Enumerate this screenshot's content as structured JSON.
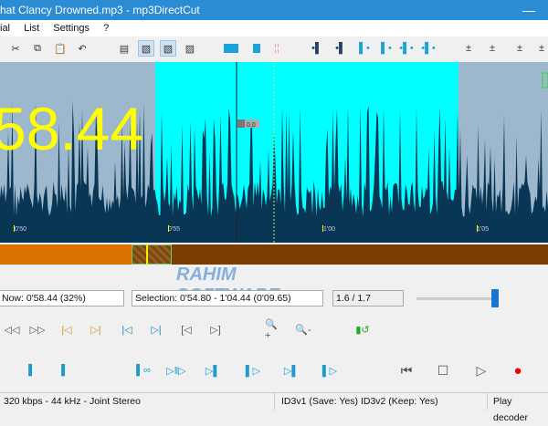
{
  "window": {
    "title": "hat Clancy Drowned.mp3 - mp3DirectCut",
    "minimize": "—"
  },
  "menu": [
    "ial",
    "List",
    "Settings",
    "?"
  ],
  "toolbar": {
    "icons": [
      "cut-icon",
      "copy-icon",
      "paste-icon",
      "undo-icon",
      "page-icon",
      "page-icon",
      "page-icon",
      "page-icon",
      "selection-block-icon",
      "selection-single-icon",
      "markers-icon",
      "set-begin-icon",
      "set-begin-icon",
      "set-end-icon",
      "set-end-icon",
      "set-both-icon",
      "set-both-icon",
      "cue-icon",
      "cue-icon",
      "cue-icon",
      "cue-icon"
    ]
  },
  "waveform": {
    "big_time": "58.44",
    "level_label": "0.0",
    "timeline": [
      "0'50",
      "0'55",
      "1'00",
      "1'05"
    ],
    "colors": {
      "bg": "#9db8cc",
      "selection": "#00ffff",
      "wave": "#0a3656"
    },
    "selection_start": "0'54",
    "selection_end": "1'04.44"
  },
  "fields": {
    "now": "Now: 0'58.44  (32%)",
    "selection": "Selection: 0'54.80 - 1'04.44 (0'09.65)",
    "counter": "1.6 / 1.7",
    "volume_fraction": 0.93
  },
  "nav_buttons": [
    "rewind-icon",
    "forward-icon",
    "prev-marker-icon",
    "next-marker-icon",
    "go-sel-start-icon",
    "go-sel-end-icon",
    "go-begin-icon",
    "go-end-icon",
    "zoom-in-icon",
    "zoom-out-icon",
    "level-undo-icon"
  ],
  "nav_glyphs": [
    "◁◁",
    "▷▷",
    "|◁",
    "▷|",
    "|◁",
    "▷|",
    "[◁",
    "▷]",
    "🔍+",
    "🔍-",
    "▮↺"
  ],
  "play_glyphs": [
    "▌",
    "▌",
    "▌∞",
    "▷‖▷",
    "▷▌",
    "▌▷",
    "▷▌",
    "▌▷",
    "⏮",
    "☐",
    "▷",
    "●"
  ],
  "status": {
    "format": "320 kbps - 44 kHz - Joint Stereo",
    "id3": "ID3v1 (Save: Yes)   ID3v2 (Keep: Yes)",
    "play": "Play decoder"
  },
  "watermark": "RAHIM SOFTWARE"
}
